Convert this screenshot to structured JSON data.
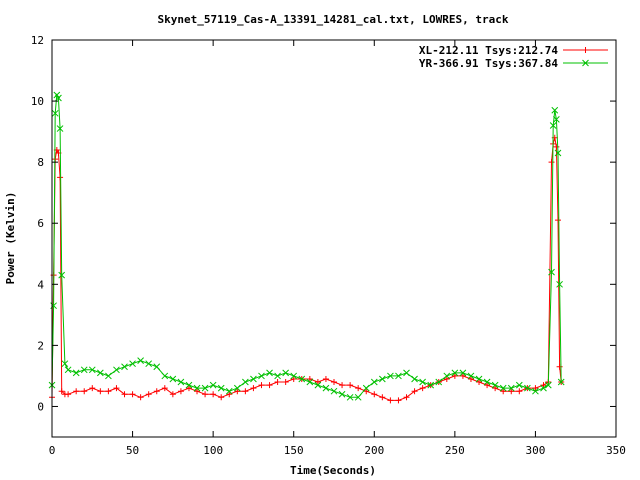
{
  "chart_data": {
    "type": "scatter",
    "title": "Skynet_57119_Cas-A_13391_14281_cal.txt, LOWRES, track",
    "xlabel": "Time(Seconds)",
    "ylabel": "Power (Kelvin)",
    "xlim": [
      0,
      350
    ],
    "ylim": [
      -1,
      12
    ],
    "xticks": [
      0,
      50,
      100,
      150,
      200,
      250,
      300,
      350
    ],
    "yticks": [
      0,
      2,
      4,
      6,
      8,
      10,
      12
    ],
    "grid": false,
    "legend_position": "top-right",
    "series": [
      {
        "name": "XL-212.11 Tsys:212.74",
        "color": "#ff0000",
        "marker": "plus",
        "x": [
          0,
          1,
          2,
          3,
          4,
          5,
          6,
          8,
          10,
          15,
          20,
          25,
          30,
          35,
          40,
          45,
          50,
          55,
          60,
          65,
          70,
          75,
          80,
          85,
          90,
          95,
          100,
          105,
          110,
          115,
          120,
          125,
          130,
          135,
          140,
          145,
          150,
          155,
          160,
          165,
          170,
          175,
          180,
          185,
          190,
          195,
          200,
          205,
          210,
          215,
          220,
          225,
          230,
          235,
          240,
          245,
          250,
          255,
          260,
          265,
          270,
          275,
          280,
          285,
          290,
          295,
          300,
          305,
          308,
          310,
          311,
          312,
          313,
          314,
          315,
          316
        ],
        "y": [
          0.3,
          4.3,
          8.1,
          8.4,
          8.3,
          7.5,
          0.5,
          0.4,
          0.4,
          0.5,
          0.5,
          0.6,
          0.5,
          0.5,
          0.6,
          0.4,
          0.4,
          0.3,
          0.4,
          0.5,
          0.6,
          0.4,
          0.5,
          0.6,
          0.5,
          0.4,
          0.4,
          0.3,
          0.4,
          0.5,
          0.5,
          0.6,
          0.7,
          0.7,
          0.8,
          0.8,
          0.9,
          0.9,
          0.9,
          0.8,
          0.9,
          0.8,
          0.7,
          0.7,
          0.6,
          0.5,
          0.4,
          0.3,
          0.2,
          0.2,
          0.3,
          0.5,
          0.6,
          0.7,
          0.8,
          0.9,
          1.0,
          1.0,
          0.9,
          0.8,
          0.7,
          0.6,
          0.5,
          0.5,
          0.5,
          0.6,
          0.6,
          0.7,
          0.8,
          8.0,
          8.6,
          8.8,
          8.5,
          6.1,
          1.3,
          0.8
        ]
      },
      {
        "name": "YR-366.91 Tsys:367.84",
        "color": "#00c000",
        "marker": "cross",
        "x": [
          0,
          1,
          2,
          3,
          4,
          5,
          6,
          8,
          10,
          15,
          20,
          25,
          30,
          35,
          40,
          45,
          50,
          55,
          60,
          65,
          70,
          75,
          80,
          85,
          90,
          95,
          100,
          105,
          110,
          115,
          120,
          125,
          130,
          135,
          140,
          145,
          150,
          155,
          160,
          165,
          170,
          175,
          180,
          185,
          190,
          195,
          200,
          205,
          210,
          215,
          220,
          225,
          230,
          235,
          240,
          245,
          250,
          255,
          260,
          265,
          270,
          275,
          280,
          285,
          290,
          295,
          300,
          305,
          308,
          310,
          311,
          312,
          313,
          314,
          315,
          316
        ],
        "y": [
          0.7,
          3.3,
          9.6,
          10.2,
          10.1,
          9.1,
          4.3,
          1.4,
          1.2,
          1.1,
          1.2,
          1.2,
          1.1,
          1.0,
          1.2,
          1.3,
          1.4,
          1.5,
          1.4,
          1.3,
          1.0,
          0.9,
          0.8,
          0.7,
          0.6,
          0.6,
          0.7,
          0.6,
          0.5,
          0.6,
          0.8,
          0.9,
          1.0,
          1.1,
          1.0,
          1.1,
          1.0,
          0.9,
          0.8,
          0.7,
          0.6,
          0.5,
          0.4,
          0.3,
          0.3,
          0.6,
          0.8,
          0.9,
          1.0,
          1.0,
          1.1,
          0.9,
          0.8,
          0.7,
          0.8,
          1.0,
          1.1,
          1.1,
          1.0,
          0.9,
          0.8,
          0.7,
          0.6,
          0.6,
          0.7,
          0.6,
          0.5,
          0.6,
          0.7,
          4.4,
          9.2,
          9.7,
          9.4,
          8.3,
          4.0,
          0.8
        ]
      }
    ]
  }
}
